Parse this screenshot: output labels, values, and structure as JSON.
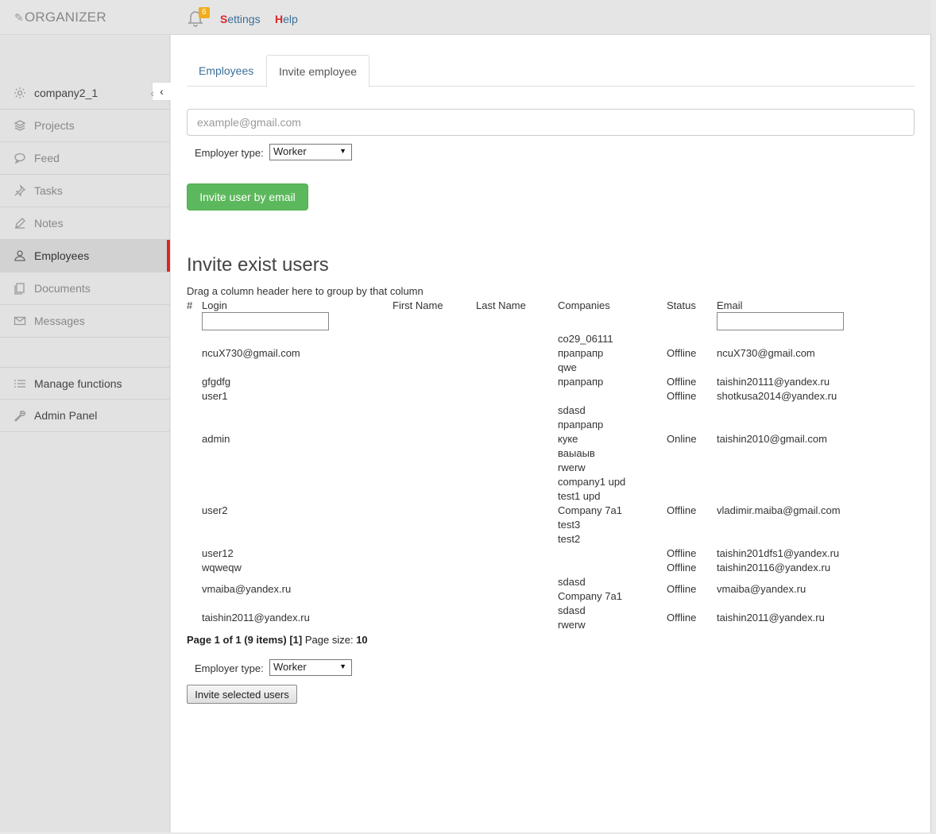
{
  "topbar": {
    "logo": "ORGANIZER",
    "notifications_count": "6",
    "settings_first": "S",
    "settings_rest": "ettings",
    "help_first": "H",
    "help_rest": "elp"
  },
  "sidebar": {
    "company": "company2_1",
    "items": [
      {
        "label": "Projects",
        "icon": "layers-icon"
      },
      {
        "label": "Feed",
        "icon": "chat-icon"
      },
      {
        "label": "Tasks",
        "icon": "pin-icon"
      },
      {
        "label": "Notes",
        "icon": "pencil-icon"
      },
      {
        "label": "Employees",
        "icon": "users-icon"
      },
      {
        "label": "Documents",
        "icon": "documents-icon"
      },
      {
        "label": "Messages",
        "icon": "envelope-icon"
      }
    ],
    "bottom_items": [
      {
        "label": "Manage functions",
        "icon": "list-icon"
      },
      {
        "label": "Admin Panel",
        "icon": "wrench-icon"
      }
    ],
    "active": "Employees"
  },
  "tabs": [
    {
      "label": "Employees"
    },
    {
      "label": "Invite employee"
    }
  ],
  "invite_form": {
    "email_placeholder": "example@gmail.com",
    "employer_type_label": "Employer type:",
    "employer_type_value": "Worker",
    "invite_button": "Invite user by email"
  },
  "invite_exist": {
    "title": "Invite exist users",
    "drag_hint": "Drag a column header here to group by that column",
    "columns": [
      "#",
      "Login",
      "First Name",
      "Last Name",
      "Companies",
      "Status",
      "Email"
    ],
    "rows": [
      {
        "login": "ncuX730@gmail.com",
        "companies": [
          "co29_06111",
          "прапрапр",
          "qwe"
        ],
        "status": "Offline",
        "email": "ncuX730@gmail.com"
      },
      {
        "login": "gfgdfg",
        "companies": [
          "прапрапр"
        ],
        "status": "Offline",
        "email": "taishin20111@yandex.ru"
      },
      {
        "login": "user1",
        "companies": [],
        "status": "Offline",
        "email": "shotkusa2014@yandex.ru"
      },
      {
        "login": "admin",
        "companies": [
          "sdasd",
          "прапрапр",
          "куке",
          "ваыаыв",
          "rwerw",
          "company1 upd"
        ],
        "status": "Online",
        "email": "taishin2010@gmail.com"
      },
      {
        "login": "user2",
        "companies": [
          "test1 upd",
          "Company 7a1",
          "test3",
          "test2"
        ],
        "status": "Offline",
        "email": "vladimir.maiba@gmail.com"
      },
      {
        "login": "user12",
        "companies": [],
        "status": "Offline",
        "email": "taishin201dfs1@yandex.ru"
      },
      {
        "login": "wqweqw",
        "companies": [],
        "status": "Offline",
        "email": "taishin20116@yandex.ru"
      },
      {
        "login": "vmaiba@yandex.ru",
        "companies": [
          "sdasd",
          "Company 7a1"
        ],
        "status": "Offline",
        "email": "vmaiba@yandex.ru"
      },
      {
        "login": "taishin2011@yandex.ru",
        "companies": [
          "sdasd",
          "rwerw"
        ],
        "status": "Offline",
        "email": "taishin2011@yandex.ru"
      }
    ],
    "pager": {
      "page_text": "Page 1 of 1 (9 items)",
      "page_link": "[1]",
      "size_label": "Page size:",
      "size_value": "10"
    },
    "employer_type_label": "Employer type:",
    "employer_type_value": "Worker",
    "invite_selected_button": "Invite selected users"
  }
}
